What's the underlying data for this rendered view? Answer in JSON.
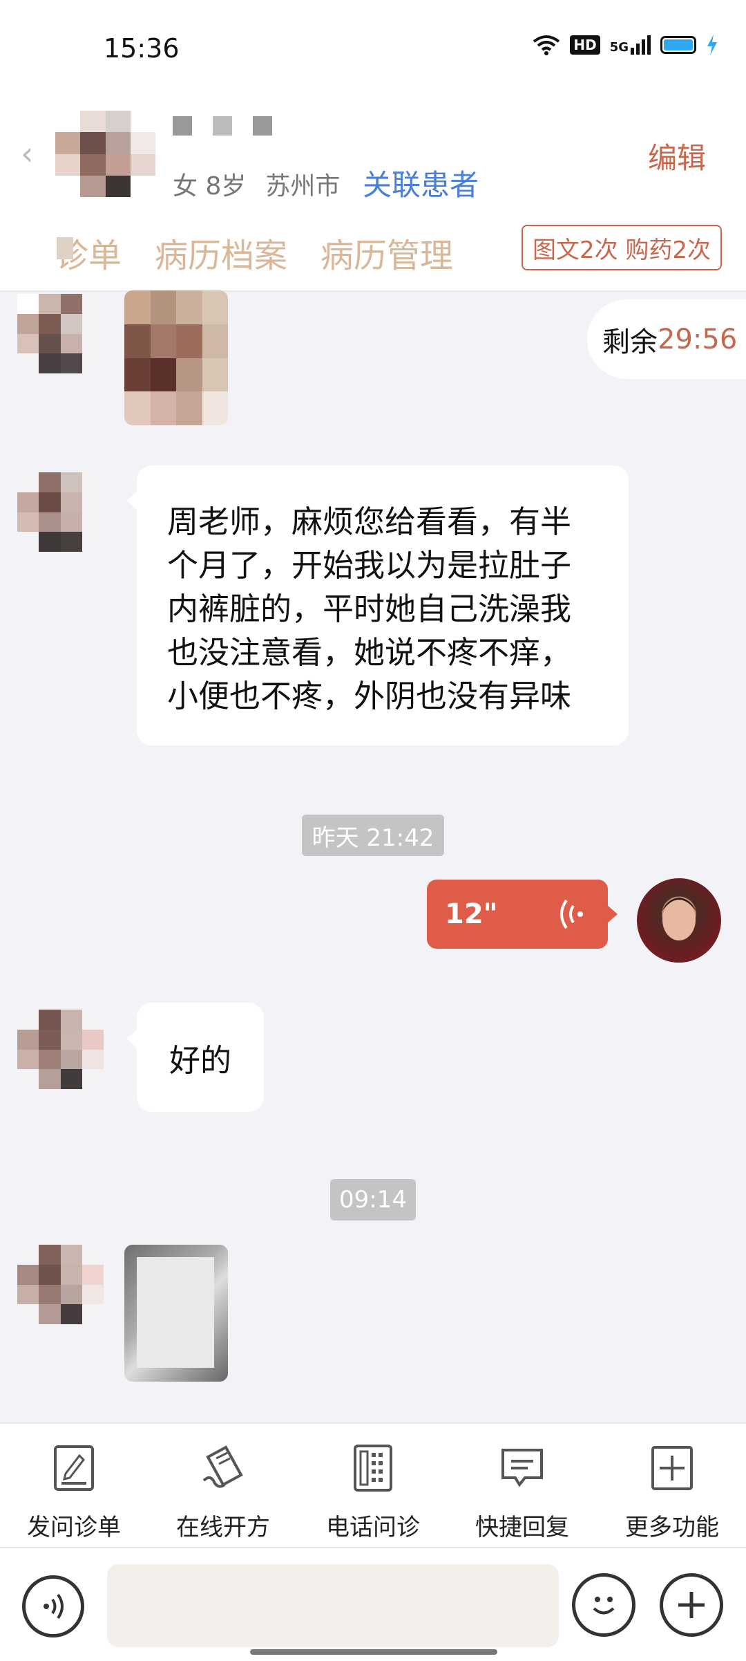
{
  "status_bar": {
    "time": "15:36",
    "hd": "HD",
    "network": "5G"
  },
  "header": {
    "patient_info": "女 8岁",
    "patient_city": "苏州市",
    "link_patient": "关联患者",
    "edit": "编辑",
    "tabs": [
      "诊单",
      "病历档案",
      "病历管理"
    ],
    "quota": "图文2次 购药2次"
  },
  "chat": {
    "timer_label": "剩余",
    "timer_value": "29:56",
    "messages": {
      "m1_lines": [
        "周老师，麻烦您给看看，有半",
        "个月了，开始我以为是拉肚子",
        "内裤脏的，平时她自己洗澡我",
        "也没注意看，她说不疼不痒，",
        "小便也不疼，外阴也没有异味"
      ],
      "m2": "好的"
    },
    "timestamps": [
      "昨天 21:42",
      "09:14"
    ],
    "voice_duration": "12\""
  },
  "toolbar": {
    "items": [
      {
        "label": "发问诊单",
        "icon": "form-edit-icon"
      },
      {
        "label": "在线开方",
        "icon": "prescription-icon"
      },
      {
        "label": "电话问诊",
        "icon": "phone-icon"
      },
      {
        "label": "快捷回复",
        "icon": "quick-reply-icon"
      },
      {
        "label": "更多功能",
        "icon": "plus-box-icon"
      }
    ]
  },
  "input_bar": {
    "voice_icon": "voice-input-icon",
    "emoji_icon": "emoji-icon",
    "plus_icon": "plus-circle-icon"
  },
  "colors": {
    "accent": "#c7674d",
    "link": "#4a7fd9",
    "voice_bubble": "#de5c48",
    "tab_text": "#d9b799",
    "background": "#f2f2f7"
  }
}
